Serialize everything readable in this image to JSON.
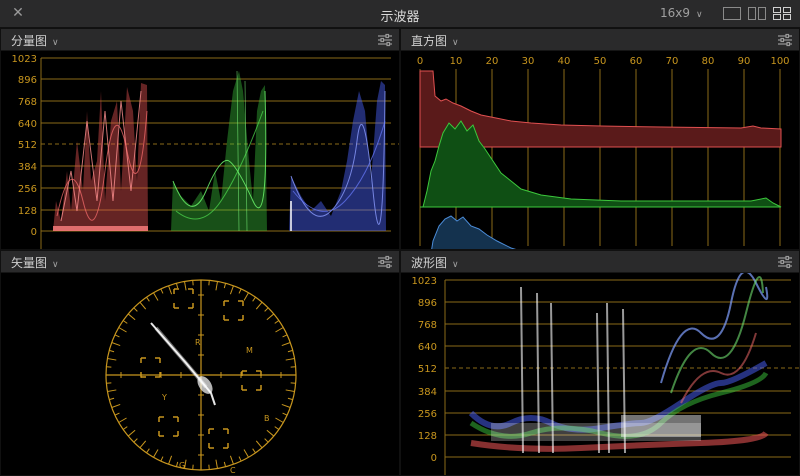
{
  "window": {
    "title": "示波器",
    "close_glyph": "✕",
    "aspect_ratio": "16x9",
    "layout_buttons": [
      "single-view",
      "dual-view",
      "quad-view"
    ]
  },
  "colors": {
    "accent_gold": "#c8961e",
    "red_channel": "#e05050",
    "green_channel": "#3cc83c",
    "blue_channel": "#4b64ff"
  },
  "panels": {
    "parade": {
      "title": "分量图",
      "y_ticks": [
        "1023",
        "896",
        "768",
        "640",
        "512",
        "384",
        "256",
        "128",
        "0"
      ]
    },
    "histogram": {
      "title": "直方图",
      "x_ticks": [
        "0",
        "10",
        "20",
        "30",
        "40",
        "50",
        "60",
        "70",
        "80",
        "90",
        "100"
      ]
    },
    "vectorscope": {
      "title": "矢量图",
      "targets": [
        "R",
        "M",
        "B",
        "C",
        "G",
        "Y"
      ]
    },
    "waveform": {
      "title": "波形图",
      "y_ticks": [
        "1023",
        "896",
        "768",
        "640",
        "512",
        "384",
        "256",
        "128",
        "0"
      ]
    }
  }
}
